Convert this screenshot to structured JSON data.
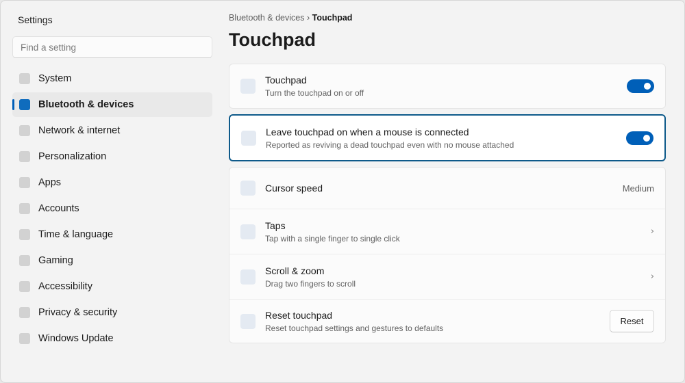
{
  "app": {
    "title": "Settings"
  },
  "search": {
    "placeholder": "Find a setting"
  },
  "sidebar": {
    "items": [
      {
        "label": "System"
      },
      {
        "label": "Bluetooth & devices",
        "active": true
      },
      {
        "label": "Network & internet"
      },
      {
        "label": "Personalization"
      },
      {
        "label": "Apps"
      },
      {
        "label": "Accounts"
      },
      {
        "label": "Time & language"
      },
      {
        "label": "Gaming"
      },
      {
        "label": "Accessibility"
      },
      {
        "label": "Privacy & security"
      },
      {
        "label": "Windows Update"
      }
    ]
  },
  "breadcrumb": {
    "parent": "Bluetooth & devices",
    "separator": "›",
    "current": "Touchpad"
  },
  "page": {
    "title": "Touchpad"
  },
  "settings": {
    "touchpad": {
      "title": "Touchpad",
      "subtitle": "Turn the touchpad on or off",
      "enabled": true
    },
    "leave_on": {
      "title": "Leave touchpad on when a mouse is connected",
      "subtitle": "Reported as reviving a dead touchpad even with no mouse attached",
      "enabled": true
    },
    "cursor_speed": {
      "title": "Cursor speed",
      "value": "Medium"
    },
    "taps": {
      "title": "Taps",
      "subtitle": "Tap with a single finger to single click",
      "chevron": "›"
    },
    "scroll_zoom": {
      "title": "Scroll & zoom",
      "subtitle": "Drag two fingers to scroll",
      "chevron": "›"
    },
    "reset": {
      "title": "Reset touchpad",
      "subtitle": "Reset touchpad settings and gestures to defaults",
      "button_label": "Reset"
    }
  },
  "colors": {
    "accent": "#005fb8",
    "highlight_border": "#0e5a8a",
    "background": "#f3f3f3"
  }
}
